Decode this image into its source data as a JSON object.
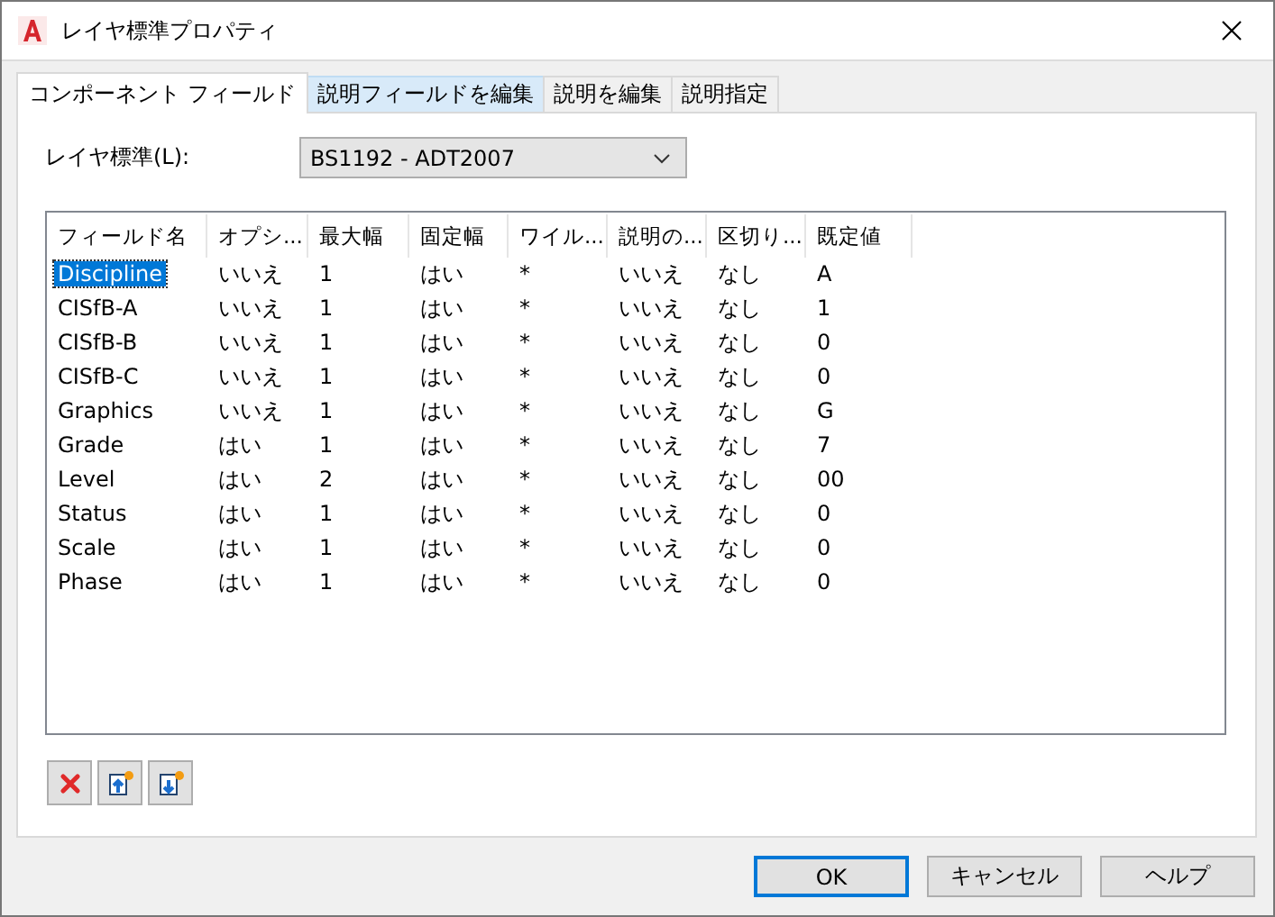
{
  "window": {
    "title": "レイヤ標準プロパティ"
  },
  "tabs": [
    {
      "label": "コンポーネント フィールド",
      "selected": true,
      "hovered": false
    },
    {
      "label": "説明フィールドを編集",
      "selected": false,
      "hovered": true
    },
    {
      "label": "説明を編集",
      "selected": false,
      "hovered": false
    },
    {
      "label": "説明指定",
      "selected": false,
      "hovered": false
    }
  ],
  "layer_standard": {
    "label": "レイヤ標準(L):",
    "value": "BS1192 - ADT2007"
  },
  "table": {
    "columns": [
      "フィールド名",
      "オプシ...",
      "最大幅",
      "固定幅",
      "ワイル...",
      "説明の...",
      "区切り...",
      "既定値"
    ],
    "rows": [
      {
        "cells": [
          "Discipline",
          "いいえ",
          "1",
          "はい",
          "*",
          "いいえ",
          "なし",
          "A"
        ],
        "selected": true
      },
      {
        "cells": [
          "CISfB-A",
          "いいえ",
          "1",
          "はい",
          "*",
          "いいえ",
          "なし",
          "1"
        ],
        "selected": false
      },
      {
        "cells": [
          "CISfB-B",
          "いいえ",
          "1",
          "はい",
          "*",
          "いいえ",
          "なし",
          "0"
        ],
        "selected": false
      },
      {
        "cells": [
          "CISfB-C",
          "いいえ",
          "1",
          "はい",
          "*",
          "いいえ",
          "なし",
          "0"
        ],
        "selected": false
      },
      {
        "cells": [
          "Graphics",
          "いいえ",
          "1",
          "はい",
          "*",
          "いいえ",
          "なし",
          "G"
        ],
        "selected": false
      },
      {
        "cells": [
          "Grade",
          "はい",
          "1",
          "はい",
          "*",
          "いいえ",
          "なし",
          "7"
        ],
        "selected": false
      },
      {
        "cells": [
          "Level",
          "はい",
          "2",
          "はい",
          "*",
          "いいえ",
          "なし",
          "00"
        ],
        "selected": false
      },
      {
        "cells": [
          "Status",
          "はい",
          "1",
          "はい",
          "*",
          "いいえ",
          "なし",
          "0"
        ],
        "selected": false
      },
      {
        "cells": [
          "Scale",
          "はい",
          "1",
          "はい",
          "*",
          "いいえ",
          "なし",
          "0"
        ],
        "selected": false
      },
      {
        "cells": [
          "Phase",
          "はい",
          "1",
          "はい",
          "*",
          "いいえ",
          "なし",
          "0"
        ],
        "selected": false
      }
    ]
  },
  "tools": [
    {
      "kind": "delete"
    },
    {
      "kind": "insert-above"
    },
    {
      "kind": "insert-below"
    }
  ],
  "buttons": [
    {
      "label": "OK",
      "default": true
    },
    {
      "label": "キャンセル",
      "default": false
    },
    {
      "label": "ヘルプ",
      "default": false
    }
  ]
}
